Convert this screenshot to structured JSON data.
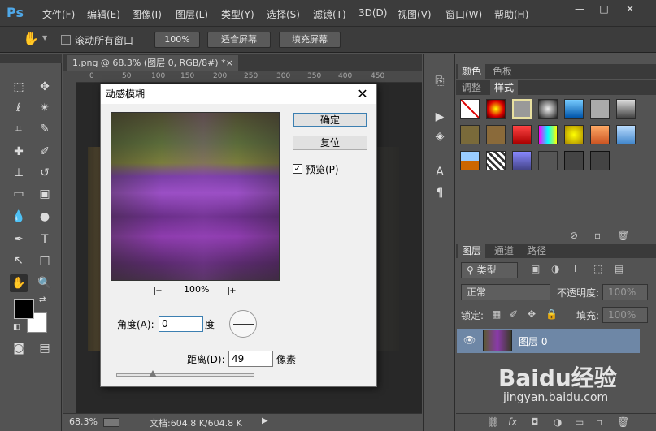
{
  "app": {
    "logo": "Ps"
  },
  "menu": [
    "文件(F)",
    "编辑(E)",
    "图像(I)",
    "图层(L)",
    "类型(Y)",
    "选择(S)",
    "滤镜(T)",
    "3D(D)",
    "视图(V)",
    "窗口(W)",
    "帮助(H)"
  ],
  "window_controls": {
    "minimize": "—",
    "maximize": "□",
    "close": "✕"
  },
  "options": {
    "scroll_all_label": "滚动所有窗口",
    "zoom100": "100%",
    "fit_screen": "适合屏幕",
    "fill_screen": "填充屏幕"
  },
  "document": {
    "tab_title": "1.png @ 68.3% (图层 0, RGB/8#) *",
    "tab_close": "×",
    "ruler_ticks": [
      "0",
      "50",
      "100",
      "150",
      "200",
      "250",
      "300",
      "350",
      "400",
      "450"
    ],
    "status_zoom": "68.3%",
    "status_doc": "文档:604.8 K/604.8 K"
  },
  "dialog": {
    "title": "动感模糊",
    "close": "✕",
    "ok": "确定",
    "reset": "复位",
    "preview_label": "预览(P)",
    "preview_checked": true,
    "zoom_value": "100%",
    "zoom_out": "−",
    "zoom_in": "+",
    "angle_label": "角度(A):",
    "angle_value": "0",
    "angle_unit": "度",
    "distance_label": "距离(D):",
    "distance_value": "49",
    "distance_unit": "像素"
  },
  "panels": {
    "top_tabs": [
      "颜色",
      "色板"
    ],
    "style_tabs": [
      "调整",
      "样式"
    ],
    "layer_tabs": [
      "图层",
      "通道",
      "路径"
    ],
    "kind_label": "类型",
    "blend_mode": "正常",
    "opacity_label": "不透明度:",
    "opacity_value": "100%",
    "lock_label": "锁定:",
    "fill_label": "填充:",
    "fill_value": "100%",
    "layer_name": "图层 0"
  },
  "watermark": {
    "brand": "Baidu经验",
    "url": "jingyan.baidu.com"
  },
  "colors": {
    "accent": "#3c7fb1",
    "layer_selected": "#6e87a6",
    "ps_blue": "#4fa8e8"
  }
}
